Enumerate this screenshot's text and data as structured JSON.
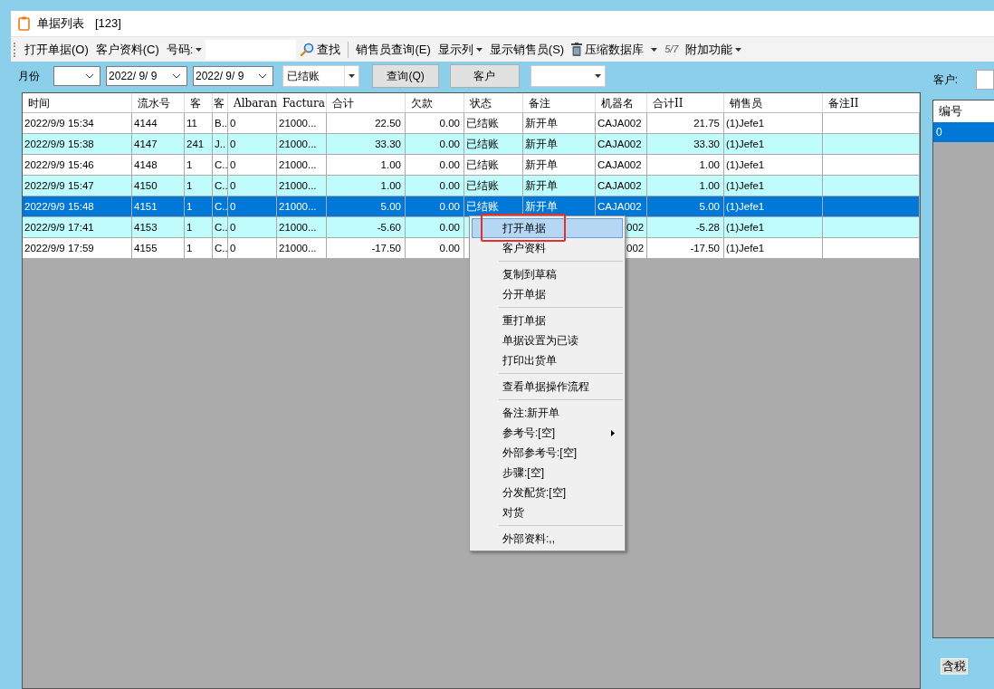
{
  "window": {
    "title": "单据列表",
    "count": "[123]"
  },
  "toolbar": [
    {
      "kind": "button",
      "label": "打开单据(O)"
    },
    {
      "kind": "button",
      "label": "客户资料(C)"
    },
    {
      "kind": "dropdown",
      "label": "号码:"
    },
    {
      "kind": "field"
    },
    {
      "kind": "search",
      "label": "查找"
    },
    {
      "kind": "divider"
    },
    {
      "kind": "button",
      "label": "销售员查询(E)"
    },
    {
      "kind": "dropdown",
      "label": "显示列"
    },
    {
      "kind": "button",
      "label": "显示销售员(S)"
    },
    {
      "kind": "trash",
      "label": "压缩数据库"
    },
    {
      "kind": "dropdown"
    },
    {
      "kind": "pager",
      "label": "5/7"
    },
    {
      "kind": "dropdown",
      "label": "附加功能"
    }
  ],
  "filter": {
    "month_label": "月份",
    "date_from": "2022/ 9/ 9",
    "date_to": "2022/ 9/ 9",
    "status": "已结账",
    "query_button": "查询(Q)",
    "customer_button": "客户",
    "customer_label": "客户:"
  },
  "table": {
    "columns": [
      {
        "label": "时间",
        "kind": "text"
      },
      {
        "label": "流水号",
        "kind": "text"
      },
      {
        "label": "客",
        "kind": "text"
      },
      {
        "label": "客",
        "kind": "text"
      },
      {
        "label": "Albaran",
        "kind": "text"
      },
      {
        "label": "Factura",
        "kind": "text"
      },
      {
        "label": "合计",
        "kind": "number"
      },
      {
        "label": "欠款",
        "kind": "number"
      },
      {
        "label": "状态",
        "kind": "text"
      },
      {
        "label": "备注",
        "kind": "text"
      },
      {
        "label": "机器名",
        "kind": "text"
      },
      {
        "label": "合计II",
        "kind": "number"
      },
      {
        "label": "销售员",
        "kind": "text"
      },
      {
        "label": "备注II",
        "kind": "text"
      }
    ],
    "rows": [
      {
        "selected": false,
        "cells": [
          "2022/9/9 15:34",
          "4144",
          "11",
          "B..",
          "0",
          "21000...",
          "22.50",
          "0.00",
          "已结账",
          "新开单",
          "CAJA002",
          "21.75",
          "(1)Jefe1",
          null
        ]
      },
      {
        "selected": false,
        "cells": [
          "2022/9/9 15:38",
          "4147",
          "241",
          "J..",
          "0",
          "21000...",
          "33.30",
          "0.00",
          "已结账",
          "新开单",
          "CAJA002",
          "33.30",
          "(1)Jefe1",
          null
        ]
      },
      {
        "selected": false,
        "cells": [
          "2022/9/9 15:46",
          "4148",
          "1",
          "C..",
          "0",
          "21000...",
          "1.00",
          "0.00",
          "已结账",
          "新开单",
          "CAJA002",
          "1.00",
          "(1)Jefe1",
          null
        ]
      },
      {
        "selected": false,
        "cells": [
          "2022/9/9 15:47",
          "4150",
          "1",
          "C..",
          "0",
          "21000...",
          "1.00",
          "0.00",
          "已结账",
          "新开单",
          "CAJA002",
          "1.00",
          "(1)Jefe1",
          null
        ]
      },
      {
        "selected": true,
        "cells": [
          "2022/9/9 15:48",
          "4151",
          "1",
          "C..",
          "0",
          "21000...",
          "5.00",
          "0.00",
          "已结账",
          "新开单",
          "CAJA002",
          "5.00",
          "(1)Jefe1",
          null
        ]
      },
      {
        "selected": false,
        "cells": [
          "2022/9/9 17:41",
          "4153",
          "1",
          "C..",
          "0",
          "21000...",
          "-5.60",
          "0.00",
          null,
          null,
          "002",
          "-5.28",
          "(1)Jefe1",
          null
        ]
      },
      {
        "selected": false,
        "cells": [
          "2022/9/9 17:59",
          "4155",
          "1",
          "C..",
          "0",
          "21000...",
          "-17.50",
          "0.00",
          null,
          null,
          "002",
          "-17.50",
          "(1)Jefe1",
          null
        ]
      }
    ]
  },
  "side_list": {
    "header": "编号",
    "rows": [
      {
        "label": "0",
        "selected": true
      }
    ],
    "tax_button": "含税"
  },
  "context_menu": {
    "groups": [
      [
        {
          "label": "打开单据",
          "selected": true,
          "outlined": true,
          "submenu": false
        },
        {
          "label": "客户资料",
          "selected": false,
          "outlined": false,
          "submenu": false
        }
      ],
      [
        {
          "label": "复制到草稿",
          "selected": false,
          "outlined": false,
          "submenu": false
        },
        {
          "label": "分开单据",
          "selected": false,
          "outlined": false,
          "submenu": false
        }
      ],
      [
        {
          "label": "重打单据",
          "selected": false,
          "outlined": false,
          "submenu": false
        },
        {
          "label": "单据设置为已读",
          "selected": false,
          "outlined": false,
          "submenu": false
        },
        {
          "label": "打印出货单",
          "selected": false,
          "outlined": false,
          "submenu": false
        }
      ],
      [
        {
          "label": "查看单据操作流程",
          "selected": false,
          "outlined": false,
          "submenu": false
        }
      ],
      [
        {
          "label": "备注:新开单",
          "selected": false,
          "outlined": false,
          "submenu": false
        },
        {
          "label": "参考号:[空]",
          "selected": false,
          "outlined": false,
          "submenu": true
        },
        {
          "label": "外部参考号:[空]",
          "selected": false,
          "outlined": false,
          "submenu": false
        },
        {
          "label": "步骤:[空]",
          "selected": false,
          "outlined": false,
          "submenu": false
        },
        {
          "label": "分发配货:[空]",
          "selected": false,
          "outlined": false,
          "submenu": false
        },
        {
          "label": "对货",
          "selected": false,
          "outlined": false,
          "submenu": false
        }
      ],
      [
        {
          "label": "外部资料:,,",
          "selected": false,
          "outlined": false,
          "submenu": false
        }
      ]
    ]
  }
}
